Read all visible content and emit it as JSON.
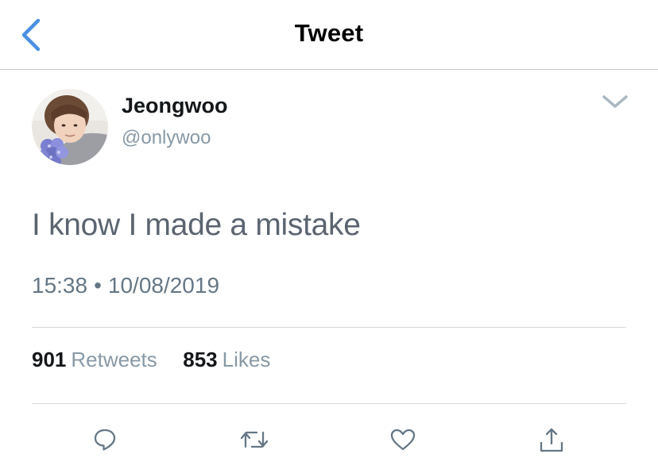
{
  "nav": {
    "back_icon": "chevron-left-icon",
    "title": "Tweet"
  },
  "tweet": {
    "author": {
      "name": "Jeongwoo",
      "handle": "@onlywoo",
      "avatar": "profile-photo"
    },
    "text": "I know I made a mistake",
    "time": "15:38",
    "separator": "•",
    "date": "10/08/2019",
    "stats": {
      "retweets_count": "901",
      "retweets_label": "Retweets",
      "likes_count": "853",
      "likes_label": "Likes"
    }
  },
  "actions": [
    {
      "name": "reply",
      "icon": "speech-bubble-icon"
    },
    {
      "name": "retweet",
      "icon": "retweet-arrows-icon"
    },
    {
      "name": "like",
      "icon": "heart-icon"
    },
    {
      "name": "share",
      "icon": "share-upload-icon"
    }
  ],
  "colors": {
    "accent": "#4a90e2",
    "muted": "#8899a6",
    "text": "#14171a",
    "divider": "#d6d9dc"
  }
}
